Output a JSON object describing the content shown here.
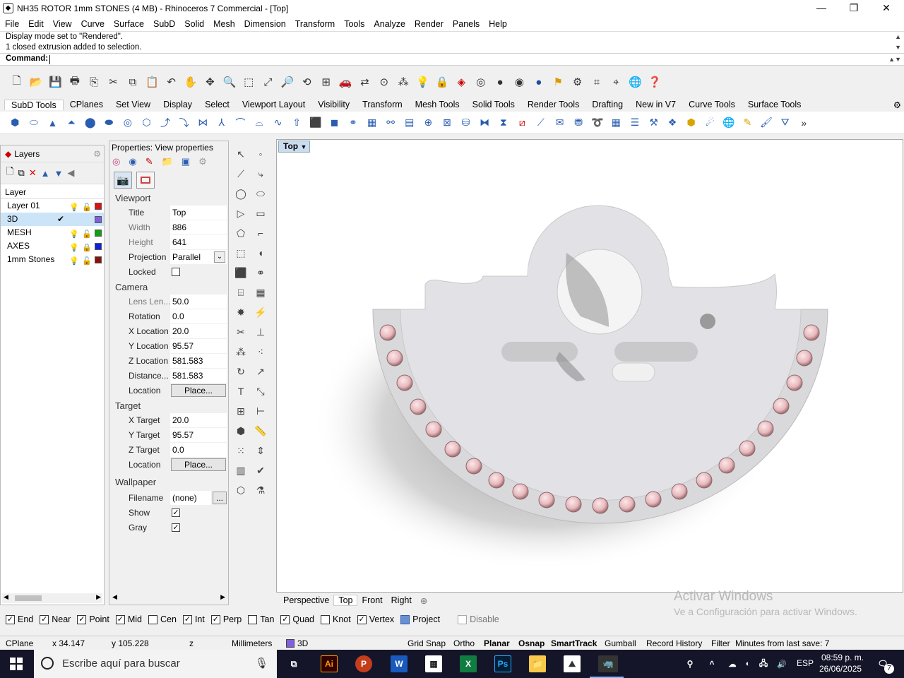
{
  "window": {
    "title": "NH35 ROTOR 1mm STONES (4 MB) - Rhinoceros 7 Commercial - [Top]"
  },
  "menu": [
    "File",
    "Edit",
    "View",
    "Curve",
    "Surface",
    "SubD",
    "Solid",
    "Mesh",
    "Dimension",
    "Transform",
    "Tools",
    "Analyze",
    "Render",
    "Panels",
    "Help"
  ],
  "command": {
    "history": [
      "Display mode set to \"Rendered\".",
      "1 closed extrusion added to selection."
    ],
    "prompt": "Command:"
  },
  "toolbar_tabs": [
    "SubD Tools",
    "CPlanes",
    "Set View",
    "Display",
    "Select",
    "Viewport Layout",
    "Visibility",
    "Transform",
    "Mesh Tools",
    "Solid Tools",
    "Render Tools",
    "Drafting",
    "New in V7",
    "Curve Tools",
    "Surface Tools"
  ],
  "layers": {
    "tab_label": "Layers",
    "column_header": "Layer",
    "rows": [
      {
        "name": "Layer 01",
        "color": "#e01010"
      },
      {
        "name": "3D",
        "color": "#8060e0",
        "selected": true,
        "current": true
      },
      {
        "name": "MESH",
        "color": "#10a010"
      },
      {
        "name": "AXES",
        "color": "#1020e0"
      },
      {
        "name": "1mm Stones",
        "color": "#8a1010"
      }
    ]
  },
  "properties": {
    "title": "Properties: View properties",
    "viewport": {
      "section": "Viewport",
      "title_label": "Title",
      "title": "Top",
      "width_label": "Width",
      "width": "886",
      "height_label": "Height",
      "height": "641",
      "projection_label": "Projection",
      "projection": "Parallel",
      "locked_label": "Locked"
    },
    "camera": {
      "section": "Camera",
      "lens_label": "Lens Len...",
      "lens": "50.0",
      "rotation_label": "Rotation",
      "rotation": "0.0",
      "xloc_label": "X Location",
      "xloc": "20.0",
      "yloc_label": "Y Location",
      "yloc": "95.57",
      "zloc_label": "Z Location",
      "zloc": "581.583",
      "distance_label": "Distance...",
      "distance": "581.583",
      "location_label": "Location",
      "place": "Place..."
    },
    "target": {
      "section": "Target",
      "x_label": "X Target",
      "x": "20.0",
      "y_label": "Y Target",
      "y": "95.57",
      "z_label": "Z Target",
      "z": "0.0",
      "location_label": "Location",
      "place": "Place..."
    },
    "wallpaper": {
      "section": "Wallpaper",
      "filename_label": "Filename",
      "filename": "(none)",
      "browse": "...",
      "show_label": "Show",
      "gray_label": "Gray"
    }
  },
  "viewport": {
    "active_label": "Top",
    "tabs": [
      "Perspective",
      "Top",
      "Front",
      "Right"
    ],
    "active_tab": "Top"
  },
  "watermark": {
    "line1": "Activar Windows",
    "line2": "Ve a Configuración para activar Windows."
  },
  "osnap": [
    {
      "label": "End",
      "checked": true
    },
    {
      "label": "Near",
      "checked": true
    },
    {
      "label": "Point",
      "checked": true
    },
    {
      "label": "Mid",
      "checked": true
    },
    {
      "label": "Cen",
      "checked": false
    },
    {
      "label": "Int",
      "checked": true
    },
    {
      "label": "Perp",
      "checked": true
    },
    {
      "label": "Tan",
      "checked": false
    },
    {
      "label": "Quad",
      "checked": true
    },
    {
      "label": "Knot",
      "checked": false
    },
    {
      "label": "Vertex",
      "checked": true
    },
    {
      "label": "Project",
      "checked": true
    },
    {
      "label": "Disable",
      "checked": false
    }
  ],
  "status": {
    "cplane": "CPlane",
    "x": "x 34.147",
    "y": "y 105.228",
    "z": "z",
    "units": "Millimeters",
    "layer": "3D",
    "grid_snap": "Grid Snap",
    "ortho": "Ortho",
    "planar": "Planar",
    "osnap": "Osnap",
    "smarttrack": "SmartTrack",
    "gumball": "Gumball",
    "record_history": "Record History",
    "filter": "Filter",
    "save": "Minutes from last save: 7"
  },
  "taskbar": {
    "search_placeholder": "Escribe aquí para buscar",
    "lang": "ESP",
    "time": "08:59 p. m.",
    "date": "26/06/2025",
    "notif_count": "7"
  }
}
